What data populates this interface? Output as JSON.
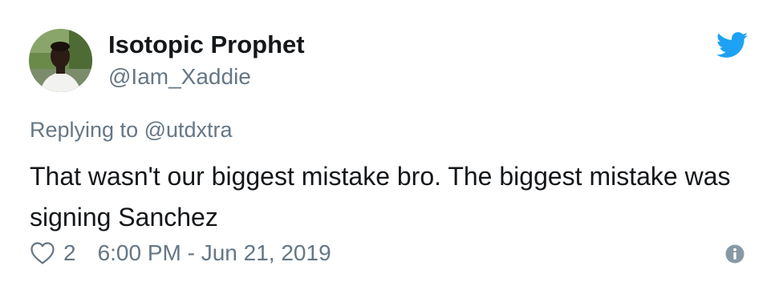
{
  "tweet": {
    "display_name": "Isotopic Prophet",
    "handle": "@Iam_Xaddie",
    "replying_prefix": "Replying to ",
    "replying_handle": "@utdxtra",
    "text": "That wasn't our biggest mistake bro. The biggest mistake was signing Sanchez",
    "like_count": "2",
    "timestamp": "6:00 PM - Jun 21, 2019"
  },
  "icons": {
    "brand": "twitter-bird-icon",
    "like": "heart-icon",
    "info": "info-icon"
  },
  "colors": {
    "brand_blue": "#1da1f2",
    "text_primary": "#14171a",
    "text_secondary": "#657786"
  }
}
